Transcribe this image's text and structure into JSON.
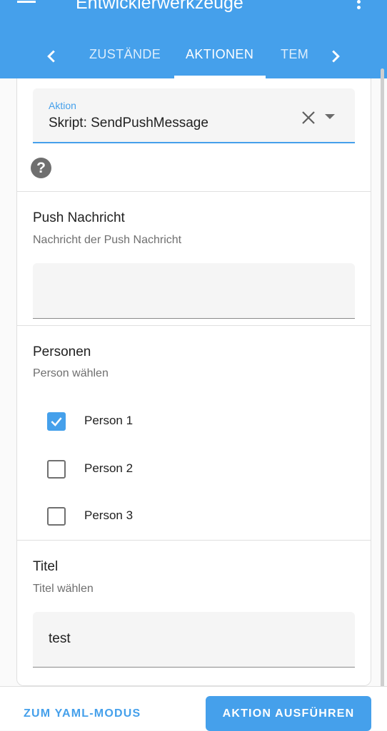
{
  "header": {
    "title": "Entwicklerwerkzeuge",
    "tabs": [
      {
        "label": "ZUSTÄNDE"
      },
      {
        "label": "AKTIONEN"
      },
      {
        "label": "TEM"
      }
    ],
    "active_tab": "AKTIONEN",
    "accent_color": "#45a0eb"
  },
  "action_select": {
    "label": "Aktion",
    "value": "Skript: SendPushMessage"
  },
  "help_icon": "?",
  "push_message": {
    "title": "Push Nachricht",
    "description": "Nachricht der Push Nachricht",
    "value": ""
  },
  "persons": {
    "title": "Personen",
    "description": "Person wählen",
    "items": [
      {
        "label": "Person 1",
        "checked": true
      },
      {
        "label": "Person 2",
        "checked": false
      },
      {
        "label": "Person 3",
        "checked": false
      }
    ]
  },
  "titel": {
    "title": "Titel",
    "description": "Titel wählen",
    "value": "test"
  },
  "footer": {
    "yaml_label": "ZUM YAML-MODUS",
    "run_label": "AKTION AUSFÜHREN"
  }
}
